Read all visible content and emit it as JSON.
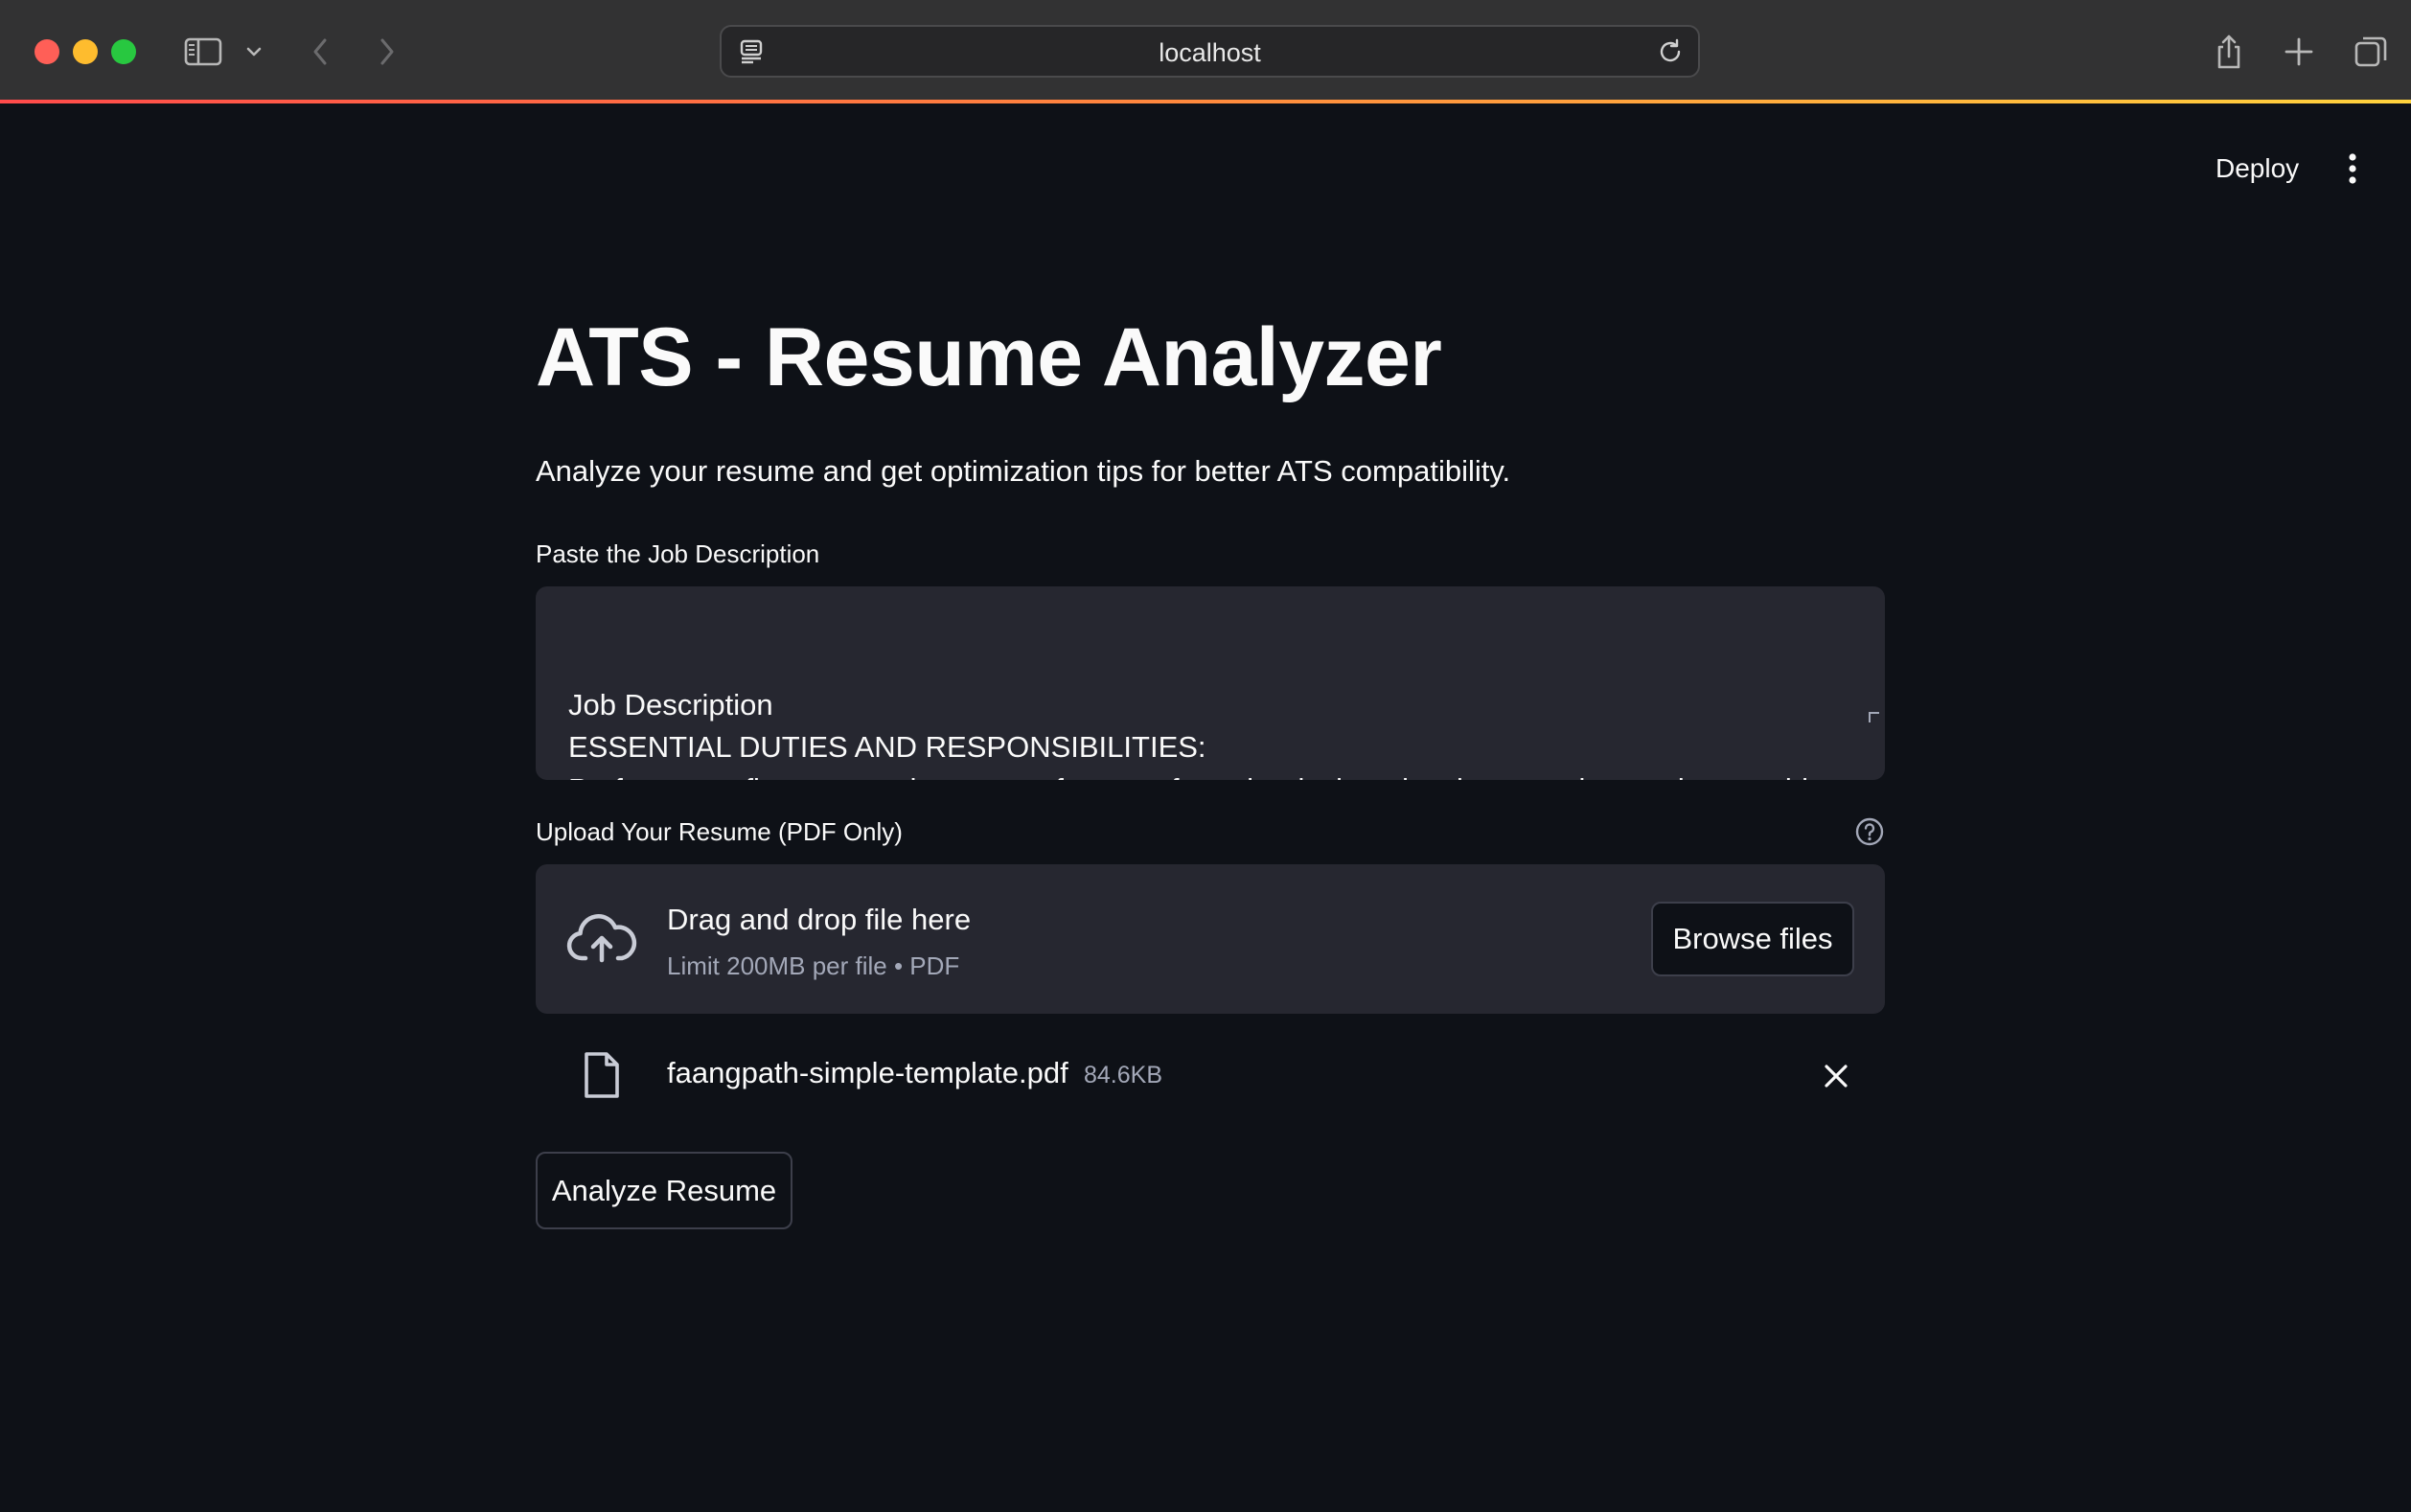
{
  "browser": {
    "url": "localhost"
  },
  "header": {
    "deploy_label": "Deploy"
  },
  "main": {
    "title": "ATS - Resume Analyzer",
    "subtitle": "Analyze your resume and get optimization tips for better ATS compatibility.",
    "job_description": {
      "label": "Paste the Job Description",
      "value": "Job Description\nESSENTIAL DUTIES AND RESPONSIBILITIES:\nPerform new firmware and customer features from the design, development, integration, trouble-shooting to customer deployment.Develop technical methodologies and provide essential input on technical strategy. Participate and provide input in critical sessions on tapeouts, reviews and roadmap"
    },
    "upload": {
      "label": "Upload Your Resume (PDF Only)",
      "dropzone_title": "Drag and drop file here",
      "dropzone_limit": "Limit 200MB per file • PDF",
      "browse_label": "Browse files",
      "file": {
        "name": "faangpath-simple-template.pdf",
        "size": "84.6KB"
      }
    },
    "analyze_label": "Analyze Resume"
  },
  "colors": {
    "background": "#0e1117",
    "surface": "#262730",
    "text": "#fafafa",
    "muted": "#a3a8b8",
    "accent": "#ff4b4b"
  }
}
